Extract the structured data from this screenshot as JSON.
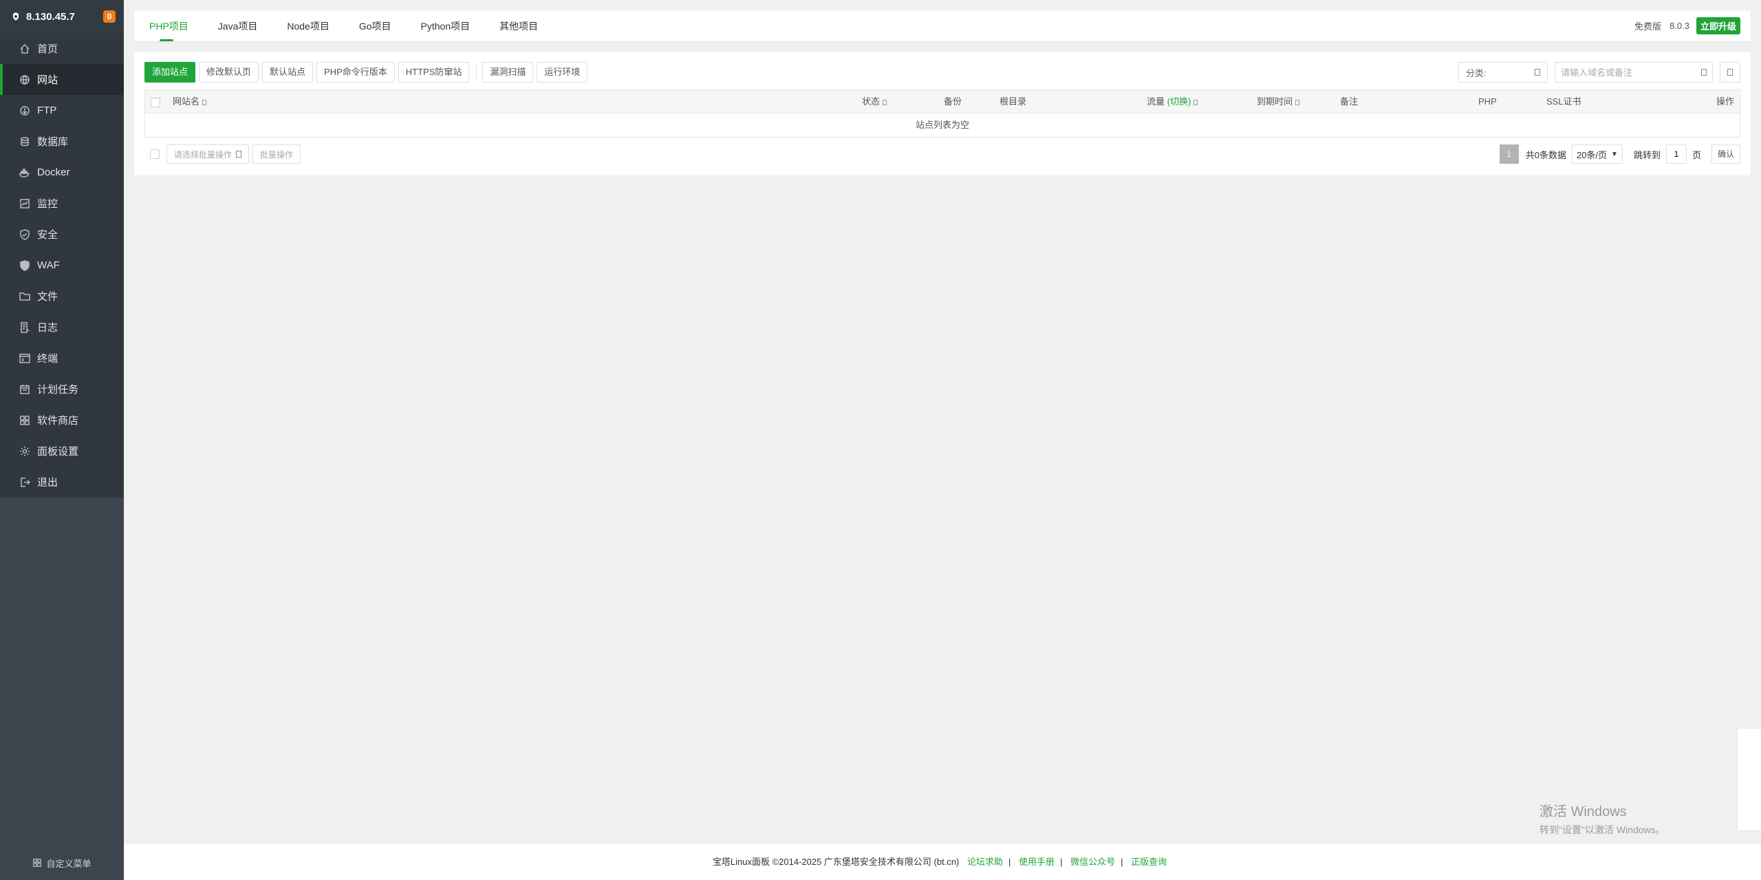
{
  "sidebar": {
    "ip": "8.130.45.7",
    "badge": "0",
    "items": [
      {
        "label": "首页",
        "icon": "home-icon"
      },
      {
        "label": "网站",
        "icon": "globe-icon"
      },
      {
        "label": "FTP",
        "icon": "ftp-icon"
      },
      {
        "label": "数据库",
        "icon": "database-icon"
      },
      {
        "label": "Docker",
        "icon": "docker-icon"
      },
      {
        "label": "监控",
        "icon": "monitor-icon"
      },
      {
        "label": "安全",
        "icon": "shield-icon"
      },
      {
        "label": "WAF",
        "icon": "waf-icon"
      },
      {
        "label": "文件",
        "icon": "folder-icon"
      },
      {
        "label": "日志",
        "icon": "log-icon"
      },
      {
        "label": "终端",
        "icon": "terminal-icon"
      },
      {
        "label": "计划任务",
        "icon": "calendar-icon"
      },
      {
        "label": "软件商店",
        "icon": "grid-icon"
      },
      {
        "label": "面板设置",
        "icon": "gear-icon"
      },
      {
        "label": "退出",
        "icon": "logout-icon"
      }
    ],
    "footer_label": "自定义菜单"
  },
  "tabs": [
    "PHP项目",
    "Java项目",
    "Node项目",
    "Go项目",
    "Python项目",
    "其他项目"
  ],
  "topbar": {
    "edition": "免费版",
    "version": "8.0.3",
    "upgrade_label": "立即升级"
  },
  "toolbar": {
    "buttons": [
      "添加站点",
      "修改默认页",
      "默认站点",
      "PHP命令行版本",
      "HTTPS防窜站"
    ],
    "buttons2": [
      "漏洞扫描",
      "运行环境"
    ]
  },
  "filters": {
    "category_label": "分类:",
    "search_placeholder": "请输入域名或备注"
  },
  "table": {
    "columns": {
      "name": "网站名",
      "status": "状态",
      "backup": "备份",
      "root": "根目录",
      "traffic": "流量",
      "traffic_switch": "(切换)",
      "expire": "到期时间",
      "remark": "备注",
      "php": "PHP",
      "ssl": "SSL证书",
      "action": "操作"
    },
    "empty_text": "站点列表为空"
  },
  "bottom": {
    "batch_placeholder": "请选择批量操作",
    "batch_button": "批量操作"
  },
  "pager": {
    "current": "1",
    "total_text": "共0条数据",
    "page_size": "20条/页",
    "jump_label": "跳转到",
    "jump_value": "1",
    "page_unit": "页",
    "confirm_label": "确认"
  },
  "footer": {
    "copyright": "宝塔Linux面板 ©2014-2025 广东堡塔安全技术有限公司 (bt.cn)",
    "links": [
      "论坛求助",
      "使用手册",
      "微信公众号",
      "正版查询"
    ]
  },
  "watermark": {
    "title": "激活 Windows",
    "subtitle": "转到\"设置\"以激活 Windows。"
  },
  "colors": {
    "accent": "#20a53a",
    "sidebar_bg": "#3c444d",
    "badge": "#ef7f1a"
  }
}
